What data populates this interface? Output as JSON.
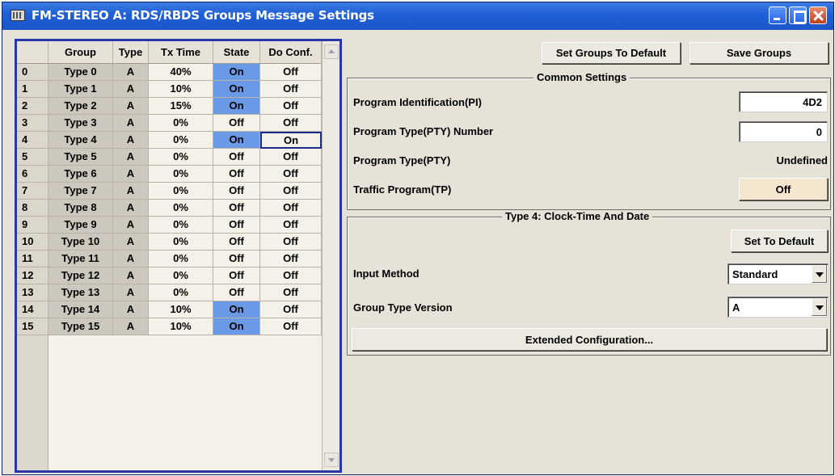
{
  "window": {
    "title": "FM-STEREO A: RDS/RBDS Groups Message Settings"
  },
  "table": {
    "headers": {
      "group": "Group",
      "type": "Type",
      "tx_time": "Tx Time",
      "state": "State",
      "do_conf": "Do Conf."
    },
    "rows": [
      {
        "idx": "0",
        "group": "Type 0",
        "type": "A",
        "tx_time": "40%",
        "state": "On",
        "do_conf": "Off"
      },
      {
        "idx": "1",
        "group": "Type 1",
        "type": "A",
        "tx_time": "10%",
        "state": "On",
        "do_conf": "Off"
      },
      {
        "idx": "2",
        "group": "Type 2",
        "type": "A",
        "tx_time": "15%",
        "state": "On",
        "do_conf": "Off"
      },
      {
        "idx": "3",
        "group": "Type 3",
        "type": "A",
        "tx_time": "0%",
        "state": "Off",
        "do_conf": "Off"
      },
      {
        "idx": "4",
        "group": "Type 4",
        "type": "A",
        "tx_time": "0%",
        "state": "On",
        "do_conf": "On"
      },
      {
        "idx": "5",
        "group": "Type 5",
        "type": "A",
        "tx_time": "0%",
        "state": "Off",
        "do_conf": "Off"
      },
      {
        "idx": "6",
        "group": "Type 6",
        "type": "A",
        "tx_time": "0%",
        "state": "Off",
        "do_conf": "Off"
      },
      {
        "idx": "7",
        "group": "Type 7",
        "type": "A",
        "tx_time": "0%",
        "state": "Off",
        "do_conf": "Off"
      },
      {
        "idx": "8",
        "group": "Type 8",
        "type": "A",
        "tx_time": "0%",
        "state": "Off",
        "do_conf": "Off"
      },
      {
        "idx": "9",
        "group": "Type 9",
        "type": "A",
        "tx_time": "0%",
        "state": "Off",
        "do_conf": "Off"
      },
      {
        "idx": "10",
        "group": "Type 10",
        "type": "A",
        "tx_time": "0%",
        "state": "Off",
        "do_conf": "Off"
      },
      {
        "idx": "11",
        "group": "Type 11",
        "type": "A",
        "tx_time": "0%",
        "state": "Off",
        "do_conf": "Off"
      },
      {
        "idx": "12",
        "group": "Type 12",
        "type": "A",
        "tx_time": "0%",
        "state": "Off",
        "do_conf": "Off"
      },
      {
        "idx": "13",
        "group": "Type 13",
        "type": "A",
        "tx_time": "0%",
        "state": "Off",
        "do_conf": "Off"
      },
      {
        "idx": "14",
        "group": "Type 14",
        "type": "A",
        "tx_time": "10%",
        "state": "On",
        "do_conf": "Off"
      },
      {
        "idx": "15",
        "group": "Type 15",
        "type": "A",
        "tx_time": "10%",
        "state": "On",
        "do_conf": "Off"
      }
    ]
  },
  "toolbar": {
    "set_groups_default": "Set Groups To Default",
    "save_groups": "Save Groups"
  },
  "common_settings": {
    "title": "Common Settings",
    "pi_label": "Program Identification(PI)",
    "pi_value": "4D2",
    "pty_number_label": "Program Type(PTY) Number",
    "pty_number_value": "0",
    "pty_label": "Program Type(PTY)",
    "pty_value": "Undefined",
    "tp_label": "Traffic Program(TP)",
    "tp_value": "Off"
  },
  "type4": {
    "title": "Type 4: Clock-Time And Date",
    "set_default": "Set To Default",
    "input_method_label": "Input Method",
    "input_method_value": "Standard",
    "group_type_version_label": "Group Type Version",
    "group_type_version_value": "A",
    "extended_config": "Extended Configuration..."
  },
  "colors": {
    "title_bar": "#1f5fd6",
    "state_on": "#6a9ae6",
    "panel_border": "#2a35a8",
    "tp_button": "#f4e6cf"
  }
}
